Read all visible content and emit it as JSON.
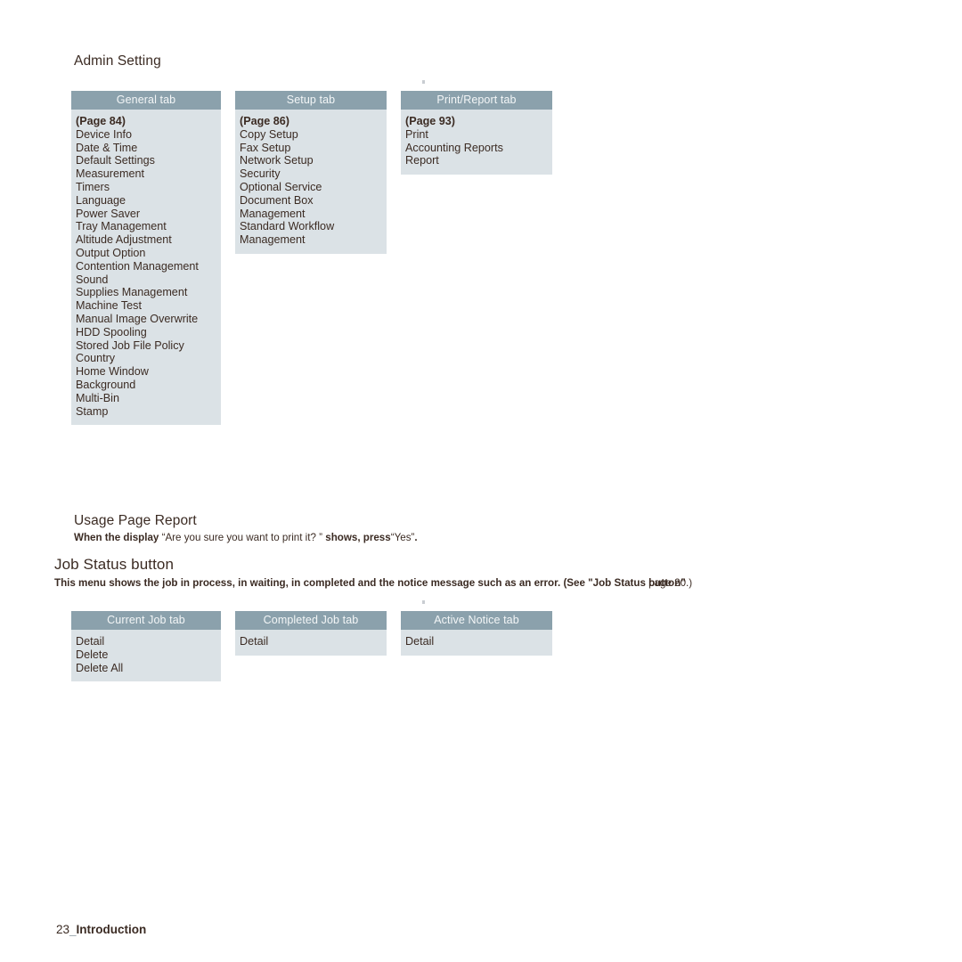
{
  "page": {
    "footer_page_number": "23",
    "footer_separator": "_",
    "footer_section_label": "Introduction"
  },
  "admin_setting": {
    "heading": "Admin Setting",
    "columns": [
      {
        "tab_label": "General tab",
        "page_reference": "(Page 84)",
        "items": [
          "Device Info",
          "Date & Time",
          "Default Settings",
          "Measurement",
          "Timers",
          "Language",
          "Power Saver",
          "Tray Management",
          "Altitude Adjustment",
          "Output Option",
          "Contention Management",
          "Sound",
          "Supplies Management",
          "Machine Test",
          "Manual Image Overwrite",
          "HDD Spooling",
          "Stored Job File Policy",
          "Country",
          "Home Window",
          "Background",
          "Multi-Bin",
          "Stamp"
        ]
      },
      {
        "tab_label": "Setup tab",
        "page_reference": "(Page 86)",
        "items": [
          "Copy Setup",
          "Fax Setup",
          "Network Setup",
          "Security",
          "Optional Service",
          "Document Box",
          "Management",
          "Standard Workflow",
          "Management"
        ]
      },
      {
        "tab_label": "Print/Report tab",
        "page_reference": "(Page 93)",
        "items": [
          "Print",
          "Accounting Reports",
          "Report"
        ]
      }
    ]
  },
  "usage_page_report": {
    "heading": "Usage Page Report",
    "instruction": {
      "bold_lead": "When the display",
      "quoted_message": "“Are you sure you want to print it?  ”",
      "bold_middle": "shows, press",
      "quoted_answer": "“Yes”",
      "trailing": "."
    }
  },
  "job_status_button": {
    "heading": "Job Status button",
    "description_start": "This menu shows the job in process, in waiting, in completed and the notice message such as an error. (See \"Job Status ",
    "overlap_bold": "button\"",
    "overlap_regular": "page 20.)",
    "columns": [
      {
        "tab_label": "Current Job tab",
        "items": [
          "Detail",
          "Delete",
          "Delete All"
        ]
      },
      {
        "tab_label": "Completed Job tab",
        "items": [
          "Detail"
        ]
      },
      {
        "tab_label": "Active Notice tab",
        "items": [
          "Detail"
        ]
      }
    ]
  },
  "colors": {
    "tab_header_bg": "#8ba1ac",
    "tab_header_text": "#f3f6f7",
    "tab_body_bg": "#dbe2e6",
    "text": "#3b2b23",
    "page_bg": "#ffffff"
  }
}
